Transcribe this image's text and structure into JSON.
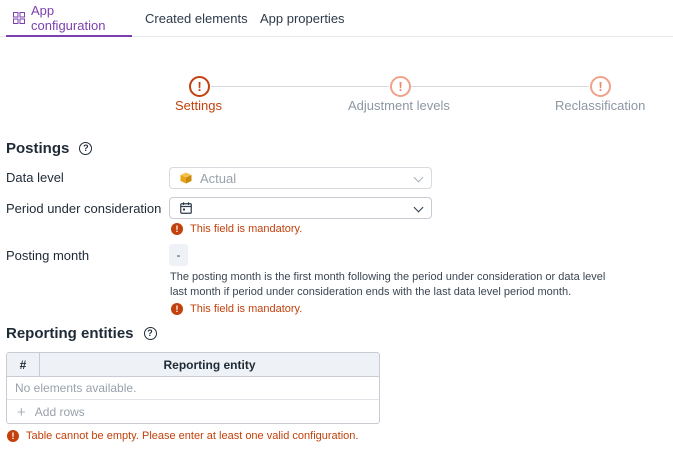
{
  "tabs": {
    "app_configuration": "App configuration",
    "created_elements": "Created elements",
    "app_properties": "App properties"
  },
  "stepper": {
    "steps": [
      {
        "label": "Settings",
        "icon": "!",
        "state": "active"
      },
      {
        "label": "Adjustment levels",
        "icon": "!",
        "state": "inactive"
      },
      {
        "label": "Reclassification",
        "icon": "!",
        "state": "inactive"
      }
    ]
  },
  "postings": {
    "title": "Postings",
    "help": "?",
    "data_level": {
      "label": "Data level",
      "value": "Actual"
    },
    "period": {
      "label": "Period under consideration",
      "value": "",
      "error": "This field is mandatory."
    },
    "posting_month": {
      "label": "Posting month",
      "value": "-",
      "help_text": "The posting month is the first month following the period under consideration or data level last month if period under consideration ends with the last data level period month.",
      "error": "This field is mandatory."
    }
  },
  "reporting": {
    "title": "Reporting entities",
    "help": "?",
    "table": {
      "col_hash": "#",
      "col_entity": "Reporting entity",
      "empty": "No elements available.",
      "add_rows": "Add rows"
    },
    "error": "Table cannot be empty. Please enter at least one valid configuration."
  },
  "colors": {
    "accent": "#7b3fb0",
    "error": "#c2410c",
    "step_inactive": "#ec8a6c",
    "cube": "#e8a317"
  }
}
